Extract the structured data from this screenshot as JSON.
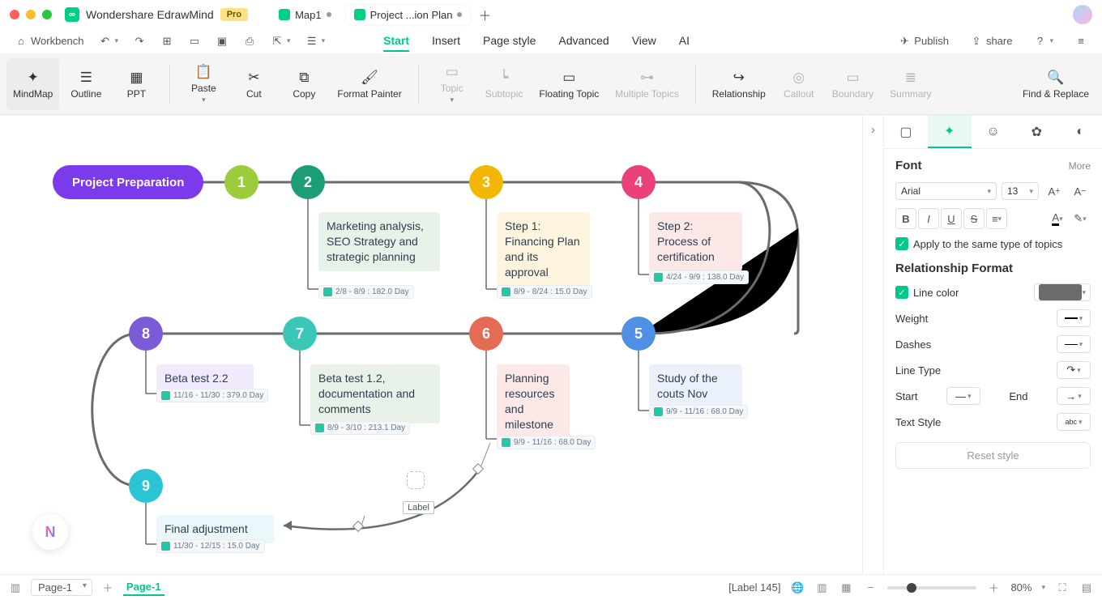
{
  "app": {
    "title": "Wondershare EdrawMind",
    "pro": "Pro"
  },
  "fileTabs": [
    {
      "label": "Map1",
      "dirty": true,
      "active": false
    },
    {
      "label": "Project ...ion Plan",
      "dirty": true,
      "active": true
    }
  ],
  "quick": {
    "workbench": "Workbench"
  },
  "menus": {
    "start": "Start",
    "insert": "Insert",
    "pageStyle": "Page style",
    "advanced": "Advanced",
    "view": "View",
    "ai": "AI"
  },
  "actions": {
    "publish": "Publish",
    "share": "share"
  },
  "ribbon": {
    "mindmap": "MindMap",
    "outline": "Outline",
    "ppt": "PPT",
    "paste": "Paste",
    "cut": "Cut",
    "copy": "Copy",
    "formatPainter": "Format Painter",
    "topic": "Topic",
    "subtopic": "Subtopic",
    "floating": "Floating Topic",
    "multiple": "Multiple Topics",
    "relationship": "Relationship",
    "callout": "Callout",
    "boundary": "Boundary",
    "summary": "Summary",
    "findReplace": "Find & Replace"
  },
  "nodes": {
    "root": "Project Preparation",
    "n2": {
      "text": "Marketing analysis, SEO Strategy and strategic planning",
      "task": "2/8 - 8/9 : 182.0 Day"
    },
    "n3": {
      "text": "Step 1: Financing Plan and its approval",
      "task": "8/9 - 8/24 : 15.0 Day"
    },
    "n4": {
      "text": "Step 2: Process of certification",
      "task": "4/24 - 9/9 : 138.0 Day"
    },
    "n5": {
      "text": "Study of the couts Nov",
      "task": "9/9 - 11/16 : 68.0 Day"
    },
    "n6": {
      "text": "Planning resources and milestone",
      "task": "9/9 - 11/16 : 68.0 Day"
    },
    "n7": {
      "text": "Beta test 1.2, documentation and comments",
      "task": "8/9 - 3/10 : 213.1 Day"
    },
    "n8": {
      "text": "Beta test 2.2",
      "task": "11/16 - 11/30 : 379.0 Day"
    },
    "n9": {
      "text": "Final adjustment",
      "task": "11/30 - 12/15 : 15.0 Day"
    }
  },
  "relLabel": "Label",
  "panel": {
    "font": "Font",
    "more": "More",
    "fontName": "Arial",
    "fontSize": "13",
    "applySame": "Apply to the same type of topics",
    "relFmt": "Relationship Format",
    "lineColor": "Line color",
    "weight": "Weight",
    "dashes": "Dashes",
    "lineType": "Line Type",
    "start": "Start",
    "end": "End",
    "textStyle": "Text Style",
    "reset": "Reset style"
  },
  "status": {
    "page": "Page-1",
    "pageActive": "Page-1",
    "labelSel": "[Label 145]",
    "zoom": "80%"
  }
}
